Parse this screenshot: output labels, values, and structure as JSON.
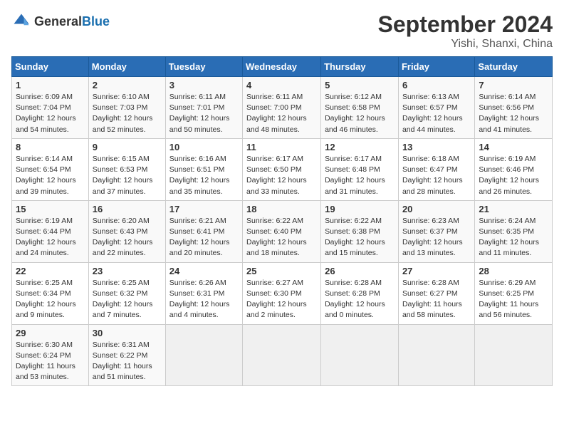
{
  "header": {
    "logo_general": "General",
    "logo_blue": "Blue",
    "month": "September 2024",
    "location": "Yishi, Shanxi, China"
  },
  "weekdays": [
    "Sunday",
    "Monday",
    "Tuesday",
    "Wednesday",
    "Thursday",
    "Friday",
    "Saturday"
  ],
  "weeks": [
    [
      {
        "day": "1",
        "info": "Sunrise: 6:09 AM\nSunset: 7:04 PM\nDaylight: 12 hours\nand 54 minutes."
      },
      {
        "day": "2",
        "info": "Sunrise: 6:10 AM\nSunset: 7:03 PM\nDaylight: 12 hours\nand 52 minutes."
      },
      {
        "day": "3",
        "info": "Sunrise: 6:11 AM\nSunset: 7:01 PM\nDaylight: 12 hours\nand 50 minutes."
      },
      {
        "day": "4",
        "info": "Sunrise: 6:11 AM\nSunset: 7:00 PM\nDaylight: 12 hours\nand 48 minutes."
      },
      {
        "day": "5",
        "info": "Sunrise: 6:12 AM\nSunset: 6:58 PM\nDaylight: 12 hours\nand 46 minutes."
      },
      {
        "day": "6",
        "info": "Sunrise: 6:13 AM\nSunset: 6:57 PM\nDaylight: 12 hours\nand 44 minutes."
      },
      {
        "day": "7",
        "info": "Sunrise: 6:14 AM\nSunset: 6:56 PM\nDaylight: 12 hours\nand 41 minutes."
      }
    ],
    [
      {
        "day": "8",
        "info": "Sunrise: 6:14 AM\nSunset: 6:54 PM\nDaylight: 12 hours\nand 39 minutes."
      },
      {
        "day": "9",
        "info": "Sunrise: 6:15 AM\nSunset: 6:53 PM\nDaylight: 12 hours\nand 37 minutes."
      },
      {
        "day": "10",
        "info": "Sunrise: 6:16 AM\nSunset: 6:51 PM\nDaylight: 12 hours\nand 35 minutes."
      },
      {
        "day": "11",
        "info": "Sunrise: 6:17 AM\nSunset: 6:50 PM\nDaylight: 12 hours\nand 33 minutes."
      },
      {
        "day": "12",
        "info": "Sunrise: 6:17 AM\nSunset: 6:48 PM\nDaylight: 12 hours\nand 31 minutes."
      },
      {
        "day": "13",
        "info": "Sunrise: 6:18 AM\nSunset: 6:47 PM\nDaylight: 12 hours\nand 28 minutes."
      },
      {
        "day": "14",
        "info": "Sunrise: 6:19 AM\nSunset: 6:46 PM\nDaylight: 12 hours\nand 26 minutes."
      }
    ],
    [
      {
        "day": "15",
        "info": "Sunrise: 6:19 AM\nSunset: 6:44 PM\nDaylight: 12 hours\nand 24 minutes."
      },
      {
        "day": "16",
        "info": "Sunrise: 6:20 AM\nSunset: 6:43 PM\nDaylight: 12 hours\nand 22 minutes."
      },
      {
        "day": "17",
        "info": "Sunrise: 6:21 AM\nSunset: 6:41 PM\nDaylight: 12 hours\nand 20 minutes."
      },
      {
        "day": "18",
        "info": "Sunrise: 6:22 AM\nSunset: 6:40 PM\nDaylight: 12 hours\nand 18 minutes."
      },
      {
        "day": "19",
        "info": "Sunrise: 6:22 AM\nSunset: 6:38 PM\nDaylight: 12 hours\nand 15 minutes."
      },
      {
        "day": "20",
        "info": "Sunrise: 6:23 AM\nSunset: 6:37 PM\nDaylight: 12 hours\nand 13 minutes."
      },
      {
        "day": "21",
        "info": "Sunrise: 6:24 AM\nSunset: 6:35 PM\nDaylight: 12 hours\nand 11 minutes."
      }
    ],
    [
      {
        "day": "22",
        "info": "Sunrise: 6:25 AM\nSunset: 6:34 PM\nDaylight: 12 hours\nand 9 minutes."
      },
      {
        "day": "23",
        "info": "Sunrise: 6:25 AM\nSunset: 6:32 PM\nDaylight: 12 hours\nand 7 minutes."
      },
      {
        "day": "24",
        "info": "Sunrise: 6:26 AM\nSunset: 6:31 PM\nDaylight: 12 hours\nand 4 minutes."
      },
      {
        "day": "25",
        "info": "Sunrise: 6:27 AM\nSunset: 6:30 PM\nDaylight: 12 hours\nand 2 minutes."
      },
      {
        "day": "26",
        "info": "Sunrise: 6:28 AM\nSunset: 6:28 PM\nDaylight: 12 hours\nand 0 minutes."
      },
      {
        "day": "27",
        "info": "Sunrise: 6:28 AM\nSunset: 6:27 PM\nDaylight: 11 hours\nand 58 minutes."
      },
      {
        "day": "28",
        "info": "Sunrise: 6:29 AM\nSunset: 6:25 PM\nDaylight: 11 hours\nand 56 minutes."
      }
    ],
    [
      {
        "day": "29",
        "info": "Sunrise: 6:30 AM\nSunset: 6:24 PM\nDaylight: 11 hours\nand 53 minutes."
      },
      {
        "day": "30",
        "info": "Sunrise: 6:31 AM\nSunset: 6:22 PM\nDaylight: 11 hours\nand 51 minutes."
      },
      {
        "day": "",
        "info": ""
      },
      {
        "day": "",
        "info": ""
      },
      {
        "day": "",
        "info": ""
      },
      {
        "day": "",
        "info": ""
      },
      {
        "day": "",
        "info": ""
      }
    ]
  ]
}
